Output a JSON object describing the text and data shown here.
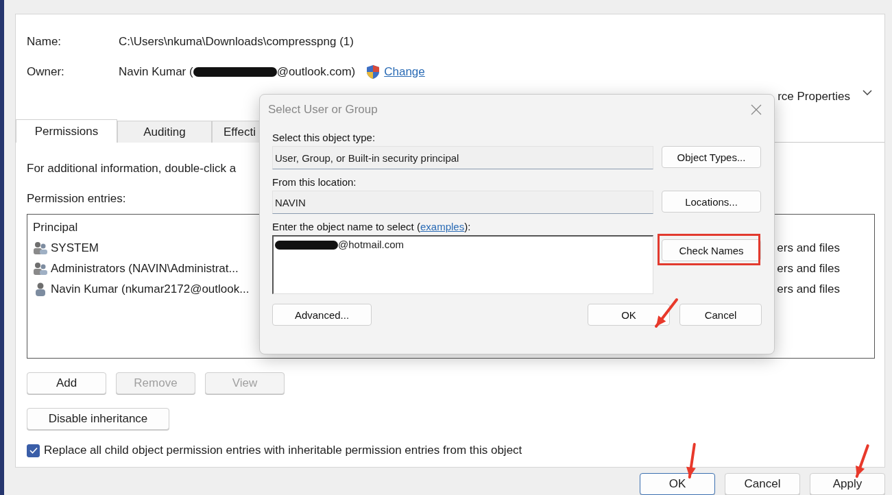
{
  "header": {
    "name_label": "Name:",
    "name_value": "C:\\Users\\nkuma\\Downloads\\compresspng (1)",
    "owner_label": "Owner:",
    "owner_prefix": "Navin Kumar (",
    "owner_suffix": "@outlook.com)",
    "change_link": "Change",
    "resource_properties": "rce Properties"
  },
  "tabs": [
    {
      "label": "Permissions",
      "selected": true
    },
    {
      "label": "Auditing",
      "selected": false
    },
    {
      "label": "Effecti",
      "selected": false
    }
  ],
  "info_text": "For additional information, double-click a",
  "entries_label": "Permission entries:",
  "list": {
    "header": "Principal",
    "rows": [
      {
        "kind": "group",
        "principal": "SYSTEM",
        "applies": "ers and files"
      },
      {
        "kind": "group",
        "principal": "Administrators (NAVIN\\Administrat...",
        "applies": "ers and files"
      },
      {
        "kind": "user",
        "principal": "Navin Kumar (nkumar2172@outlook...",
        "applies": "ers and files"
      }
    ]
  },
  "list_buttons": [
    {
      "label": "Add",
      "disabled": false
    },
    {
      "label": "Remove",
      "disabled": true
    },
    {
      "label": "View",
      "disabled": true
    }
  ],
  "disable_inheritance": "Disable inheritance",
  "replace_checkbox": {
    "label": "Replace all child object permission entries with inheritable permission entries from this object",
    "checked": true
  },
  "footer_buttons": [
    {
      "label": "OK",
      "focused": true
    },
    {
      "label": "Cancel",
      "focused": false
    },
    {
      "label": "Apply",
      "focused": false
    }
  ],
  "dialog": {
    "title": "Select User or Group",
    "object_type_label": "Select this object type:",
    "object_type_value": "User, Group, or Built-in security principal",
    "object_types_button": "Object Types...",
    "location_label": "From this location:",
    "location_value": "NAVIN",
    "locations_button": "Locations...",
    "name_label_before": "Enter the object name to select (",
    "examples_link": "examples",
    "name_label_after": "):",
    "name_value_suffix": "@hotmail.com",
    "check_names_button": "Check Names",
    "advanced_button": "Advanced...",
    "ok_button": "OK",
    "cancel_button": "Cancel"
  }
}
